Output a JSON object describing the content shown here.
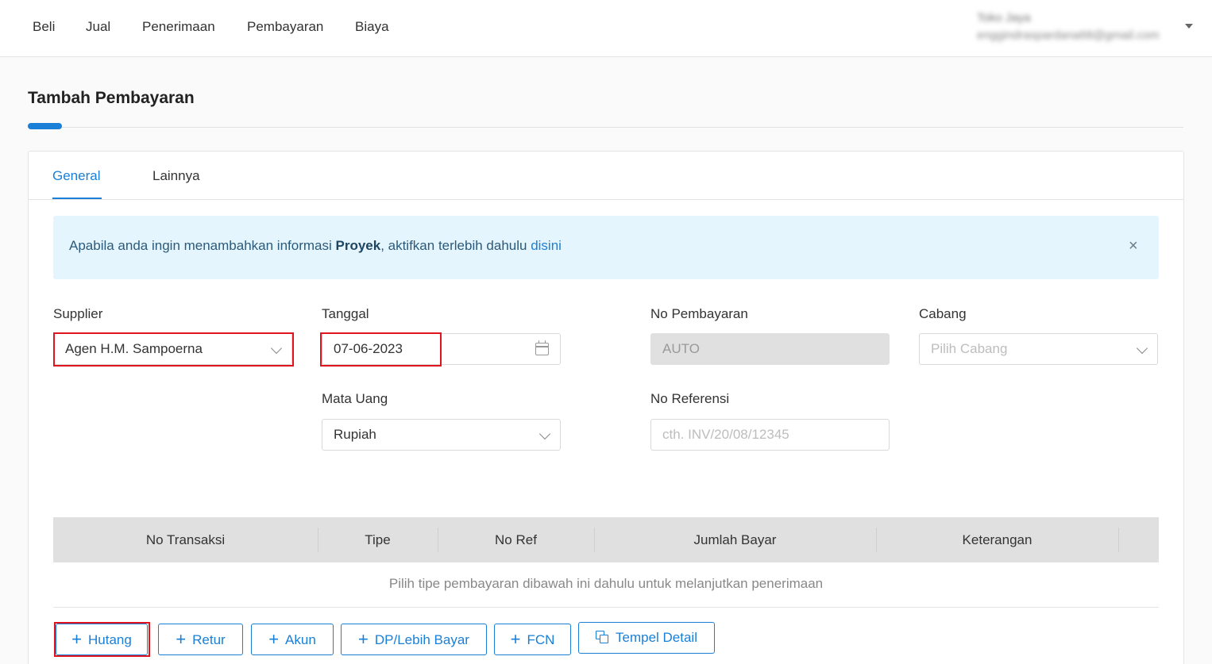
{
  "nav": {
    "items": [
      "Beli",
      "Jual",
      "Penerimaan",
      "Pembayaran",
      "Biaya"
    ],
    "user_name": "Toko Jaya",
    "user_email": "enggindraspardana68@gmail.com"
  },
  "page_title": "Tambah Pembayaran",
  "tabs": [
    "General",
    "Lainnya"
  ],
  "banner": {
    "text_before": "Apabila anda ingin menambahkan informasi ",
    "bold": "Proyek",
    "text_after": ", aktifkan terlebih dahulu ",
    "link": "disini",
    "close": "×"
  },
  "form": {
    "supplier_label": "Supplier",
    "supplier_value": "Agen H.M. Sampoerna",
    "tanggal_label": "Tanggal",
    "tanggal_value": "07-06-2023",
    "no_pembayaran_label": "No Pembayaran",
    "no_pembayaran_value": "AUTO",
    "cabang_label": "Cabang",
    "cabang_placeholder": "Pilih Cabang",
    "mata_uang_label": "Mata Uang",
    "mata_uang_value": "Rupiah",
    "no_referensi_label": "No Referensi",
    "no_referensi_placeholder": "cth. INV/20/08/12345"
  },
  "table": {
    "columns": [
      "No Transaksi",
      "Tipe",
      "No Ref",
      "Jumlah Bayar",
      "Keterangan"
    ],
    "empty_message": "Pilih tipe pembayaran dibawah ini dahulu untuk melanjutkan penerimaan"
  },
  "buttons": {
    "hutang": "Hutang",
    "retur": "Retur",
    "akun": "Akun",
    "dp": "DP/Lebih Bayar",
    "fcn": "FCN",
    "tempel": "Tempel Detail"
  },
  "colors": {
    "accent": "#1a7fd6",
    "highlight": "#e0141e",
    "banner_bg": "#e5f5fe"
  }
}
